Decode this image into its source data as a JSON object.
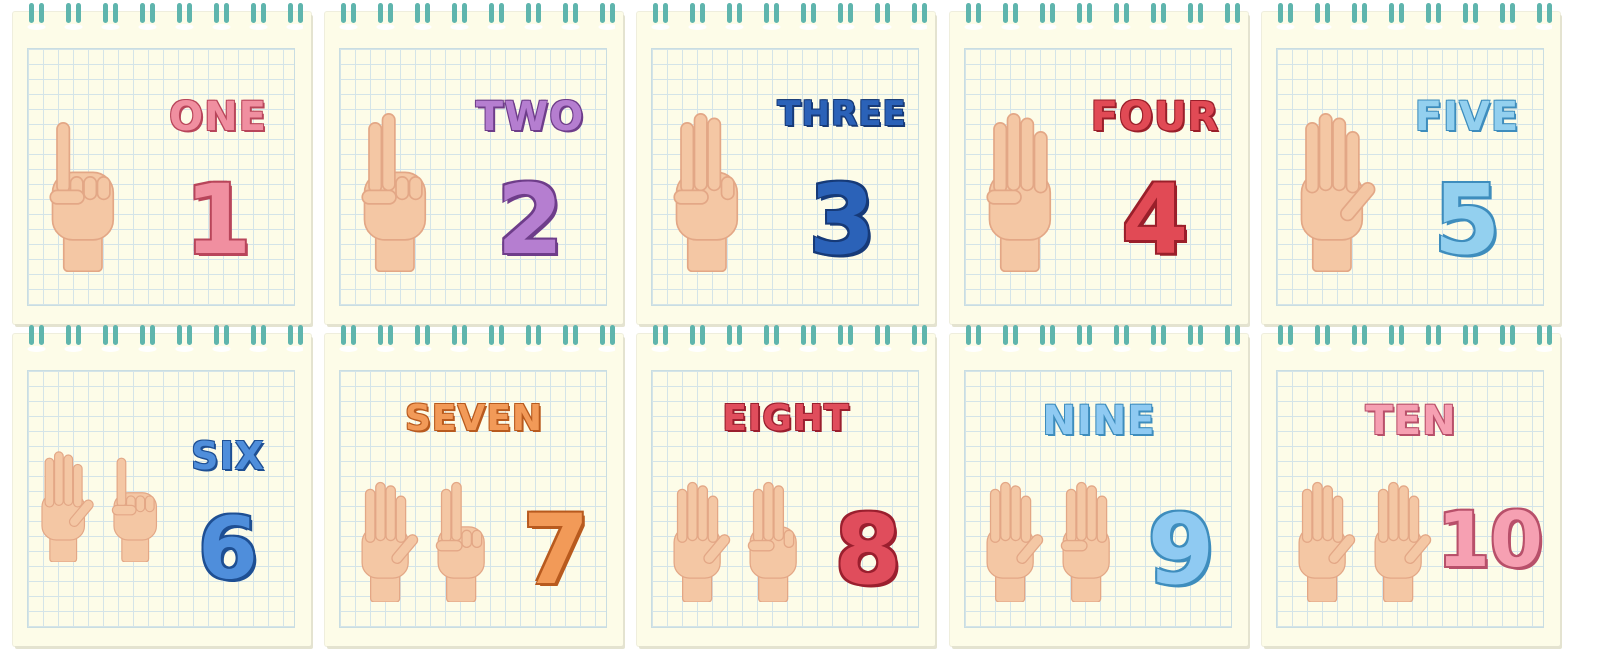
{
  "colors": {
    "paper": "#fdfce8",
    "grid": "#d4e4e8",
    "ring": "#5fb5ad",
    "skin": "#f4c7a4",
    "skin_shadow": "#e3a786"
  },
  "cards": [
    {
      "word": "ONE",
      "number": "1",
      "fingers": [
        1
      ],
      "color": "#f08fa0",
      "outline": "#b8455a",
      "layout": "side"
    },
    {
      "word": "TWO",
      "number": "2",
      "fingers": [
        2
      ],
      "color": "#b57ed0",
      "outline": "#6e3d8a",
      "layout": "side"
    },
    {
      "word": "THREE",
      "number": "3",
      "fingers": [
        3
      ],
      "color": "#2b62b8",
      "outline": "#163a78",
      "layout": "side"
    },
    {
      "word": "FOUR",
      "number": "4",
      "fingers": [
        4
      ],
      "color": "#e14a55",
      "outline": "#9a1f2a",
      "layout": "side"
    },
    {
      "word": "FIVE",
      "number": "5",
      "fingers": [
        5
      ],
      "color": "#93d0ef",
      "outline": "#3e8dbd",
      "layout": "side"
    },
    {
      "word": "SIX",
      "number": "6",
      "fingers": [
        5,
        1
      ],
      "color": "#4f8edb",
      "outline": "#1e4f93",
      "layout": "side"
    },
    {
      "word": "SEVEN",
      "number": "7",
      "fingers": [
        5,
        2
      ],
      "color": "#f29a58",
      "outline": "#b85a1e",
      "layout": "top"
    },
    {
      "word": "EIGHT",
      "number": "8",
      "fingers": [
        5,
        3
      ],
      "color": "#e04d5c",
      "outline": "#9a1f2e",
      "layout": "top"
    },
    {
      "word": "NINE",
      "number": "9",
      "fingers": [
        5,
        4
      ],
      "color": "#8fcaf2",
      "outline": "#3e8dbd",
      "layout": "top"
    },
    {
      "word": "TEN",
      "number": "10",
      "fingers": [
        5,
        5
      ],
      "color": "#f6a0b2",
      "outline": "#b8506a",
      "layout": "top"
    }
  ]
}
